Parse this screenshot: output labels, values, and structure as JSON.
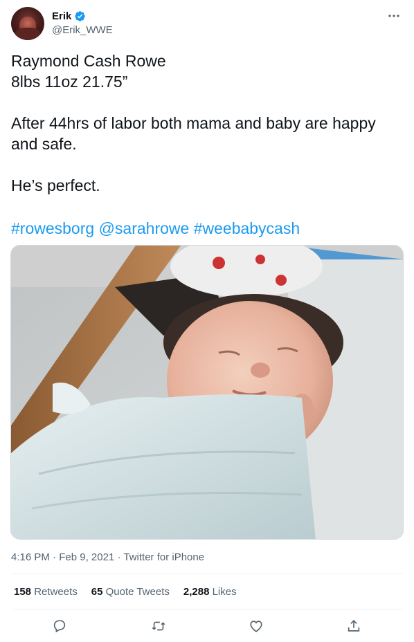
{
  "tweet": {
    "author": {
      "display_name": "Erik",
      "handle": "@Erik_WWE",
      "verified": true
    },
    "lines": [
      "Raymond Cash Rowe",
      "8lbs 11oz 21.75”",
      "After 44hrs of labor both mama and baby are happy",
      "and safe.",
      "He’s perfect."
    ],
    "tags": [
      "#rowesborg",
      "@sarahrowe",
      "#weebabycash"
    ],
    "time": "4:16 PM",
    "date": "Feb 9, 2021",
    "source": "Twitter for iPhone",
    "stats": {
      "retweets_count": "158",
      "retweets_label": "Retweets",
      "quotes_count": "65",
      "quotes_label": "Quote Tweets",
      "likes_count": "2,288",
      "likes_label": "Likes"
    },
    "actions": [
      "reply-icon",
      "retweet-icon",
      "like-icon",
      "share-icon"
    ]
  },
  "colors": {
    "accent": "#1d9bf0",
    "text": "#0f1419",
    "secondary": "#536471"
  }
}
